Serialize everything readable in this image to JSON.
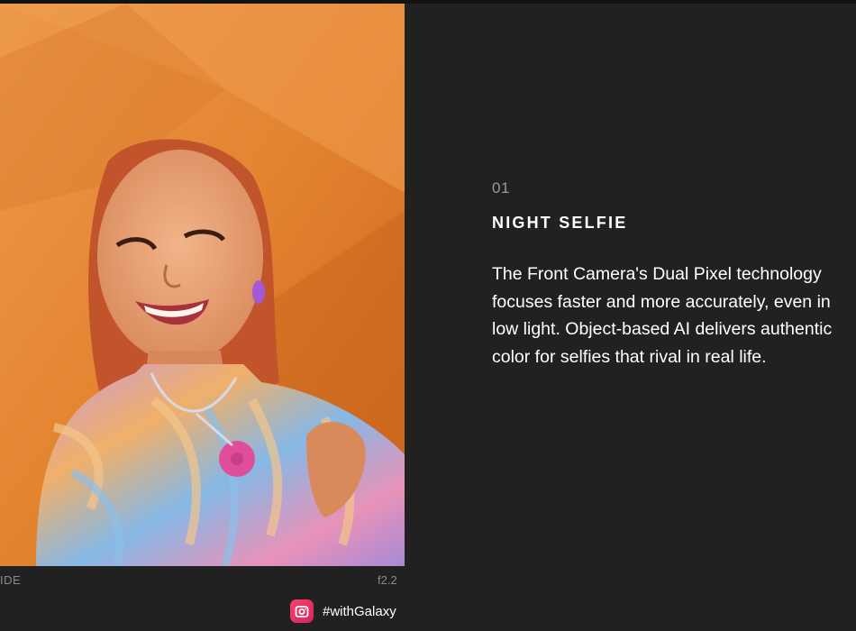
{
  "photo": {
    "alt_caption_left": "IDE",
    "aperture": "f2.2"
  },
  "hashtag": {
    "icon": "instagram-camera-icon",
    "text": "#withGalaxy",
    "icon_color": "#e8305f"
  },
  "feature": {
    "number": "01",
    "title": "NIGHT SELFIE",
    "description": "The Front Camera's Dual Pixel technology focuses faster and more accurately, even in low light. Object-based AI delivers authentic color for selfies that rival in real life."
  },
  "colors": {
    "background": "#212121",
    "photo_backdrop": "#e27f2c",
    "muted_text": "#8a8a8a"
  }
}
